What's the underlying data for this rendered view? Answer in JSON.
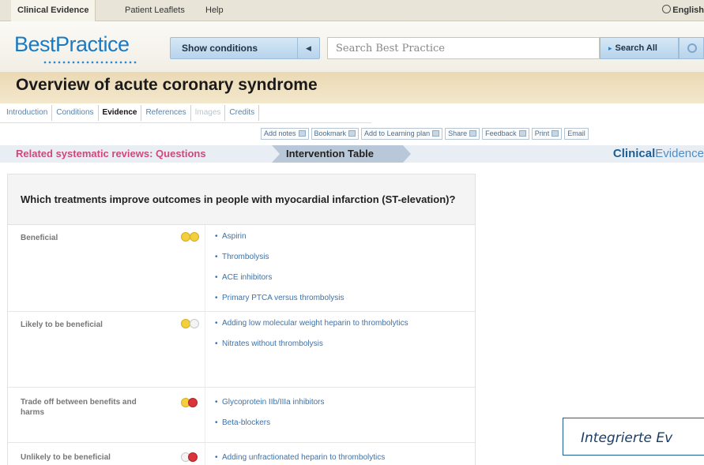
{
  "topnav": {
    "tabs": [
      "Clinical Evidence",
      "Patient Leaflets",
      "Help"
    ],
    "language": "English"
  },
  "brand": {
    "logo": "BestPractice"
  },
  "search": {
    "show_conditions": "Show conditions",
    "placeholder": "Search Best Practice",
    "search_all": "Search All"
  },
  "page": {
    "title": "Overview of acute coronary syndrome"
  },
  "section_tabs": [
    "Introduction",
    "Conditions",
    "Evidence",
    "References",
    "Images",
    "Credits"
  ],
  "toolbar": [
    "Add notes",
    "Bookmark",
    "Add to Learning plan",
    "Share",
    "Feedback",
    "Print",
    "Email"
  ],
  "breadcrumb": {
    "related": "Related systematic reviews: Questions",
    "current": "Intervention Table",
    "brand_a": "Clinical",
    "brand_b": "Evidence"
  },
  "question": "Which treatments improve outcomes in people with myocardial infarction (ST-elevation)?",
  "categories": [
    {
      "label": "Beneficial",
      "items": [
        "Aspirin",
        "Thrombolysis",
        "ACE inhibitors",
        "Primary PTCA versus thrombolysis"
      ]
    },
    {
      "label": "Likely to be beneficial",
      "items": [
        "Adding low molecular weight heparin to thrombolytics",
        "Nitrates without thrombolysis"
      ]
    },
    {
      "label": "Trade off between benefits and harms",
      "items": [
        "Glycoprotein IIb/IIIa inhibitors",
        "Beta-blockers"
      ]
    },
    {
      "label": "Unlikely to be beneficial",
      "items": [
        "Adding unfractionated heparin to thrombolytics"
      ]
    }
  ],
  "caption": "Integrierte Ev"
}
